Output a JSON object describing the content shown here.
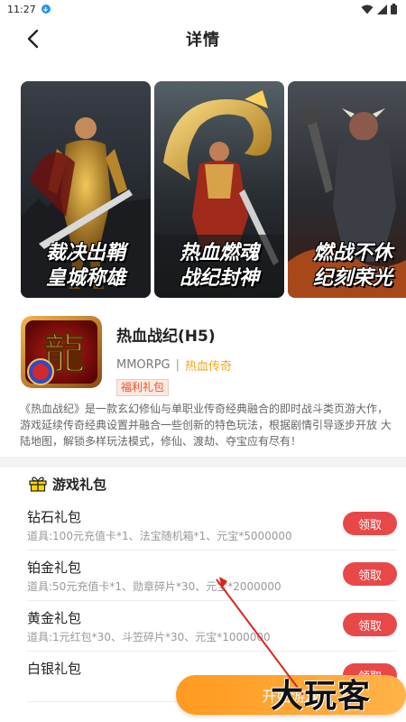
{
  "status_bar": {
    "time": "11:27"
  },
  "header": {
    "title": "详情"
  },
  "gallery": [
    {
      "caption": "裁决出鞘\n皇城称雄"
    },
    {
      "caption": "热血燃魂\n战纪封神"
    },
    {
      "caption": "燃战不休\n纪刻荣光"
    }
  ],
  "game": {
    "icon_char": "龍",
    "name": "热血战纪(H5)",
    "genre_type": "MMORPG",
    "separator": "|",
    "genre": "热血传奇",
    "badge": "福利礼包"
  },
  "description": "《热血战纪》是一款玄幻修仙与单职业传奇经典融合的即时战斗类页游大作，游戏延续传奇经典设置并融合一些创新的特色玩法，根据剧情引导逐步开放 大陆地图，解锁多样玩法模式，修仙、渡劫、夺宝应有尽有！",
  "gift_section": {
    "title": "游戏礼包",
    "claim_label": "领取",
    "gifts": [
      {
        "name": "钻石礼包",
        "items": "道具:100元充值卡*1、法宝随机箱*1、元宝*5000000"
      },
      {
        "name": "铂金礼包",
        "items": "道具:50元充值卡*1、勋章碎片*30、元宝*2000000"
      },
      {
        "name": "黄金礼包",
        "items": "道具:1元红包*30、斗笠碎片*30、元宝*1000000"
      },
      {
        "name": "白银礼包",
        "items": ""
      }
    ]
  },
  "start_button": {
    "label": "开始游戏"
  },
  "watermark": {
    "text": "大玩客"
  },
  "colors": {
    "accent": "#ffa32e",
    "claim": "#e94848",
    "genre": "#f5a623",
    "badge": "#e8542a"
  }
}
